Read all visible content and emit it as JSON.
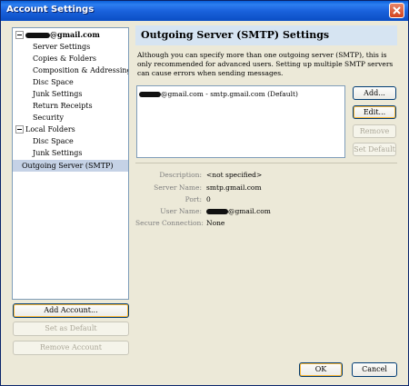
{
  "window": {
    "title": "Account Settings"
  },
  "tree": {
    "items": [
      {
        "label": "@gmail.com"
      },
      {
        "label": "Server Settings"
      },
      {
        "label": "Copies & Folders"
      },
      {
        "label": "Composition & Addressing"
      },
      {
        "label": "Disc Space"
      },
      {
        "label": "Junk Settings"
      },
      {
        "label": "Return Receipts"
      },
      {
        "label": "Security"
      },
      {
        "label": "Local Folders"
      },
      {
        "label": "Disc Space"
      },
      {
        "label": "Junk Settings"
      },
      {
        "label": "Outgoing Server (SMTP)"
      }
    ]
  },
  "left_buttons": {
    "add_account": "Add Account...",
    "set_default": "Set as Default",
    "remove_account": "Remove Account"
  },
  "panel": {
    "title": "Outgoing Server (SMTP) Settings",
    "description": "Although you can specify more than one outgoing server (SMTP), this is only recommended for advanced users. Setting up multiple SMTP servers can cause errors when sending messages.",
    "server_entry": "@gmail.com - smtp.gmail.com (Default)",
    "buttons": {
      "add": "Add...",
      "edit": "Edit...",
      "remove": "Remove",
      "set_default": "Set Default"
    },
    "details": {
      "description_label": "Description:",
      "description_value": "<not specified>",
      "server_name_label": "Server Name:",
      "server_name_value": "smtp.gmail.com",
      "port_label": "Port:",
      "port_value": "0",
      "user_name_label": "User Name:",
      "user_name_value": "@gmail.com",
      "secure_label": "Secure Connection:",
      "secure_value": "None"
    }
  },
  "dialog_buttons": {
    "ok": "OK",
    "cancel": "Cancel"
  }
}
